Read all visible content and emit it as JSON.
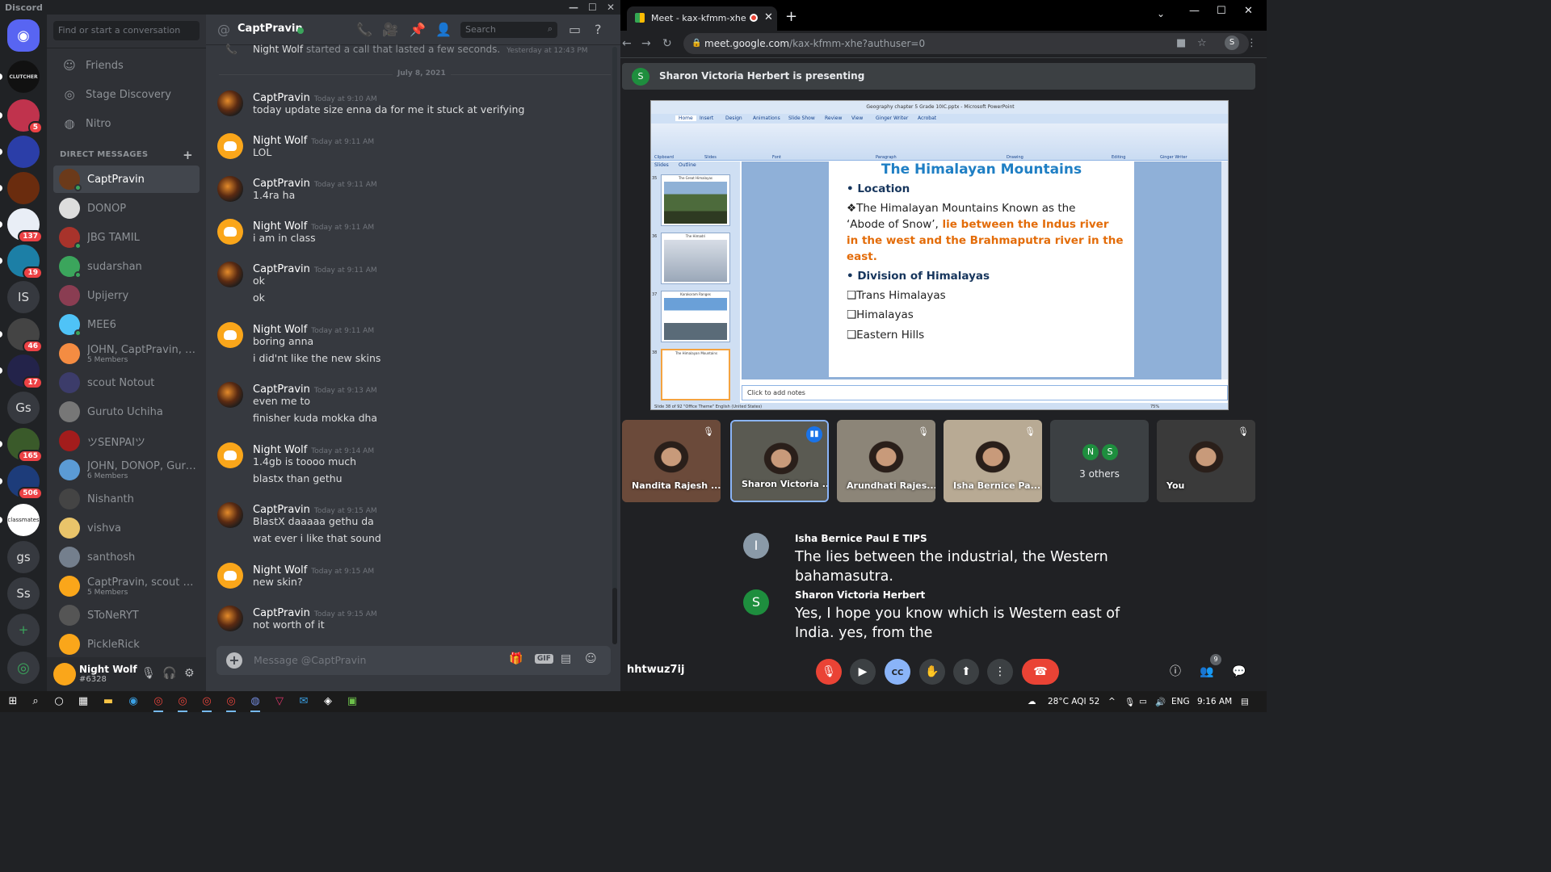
{
  "discord": {
    "app_title": "Discord",
    "guilds": [
      {
        "label": "",
        "badge": "",
        "color": "#5865f2",
        "icon": "discord-logo-icon"
      },
      {
        "label": "CLUTCHER",
        "badge": "",
        "color": "#111111"
      },
      {
        "label": "",
        "badge": "5",
        "color": "#c0334d"
      },
      {
        "label": "",
        "badge": "",
        "color": "#2b3ea8"
      },
      {
        "label": "",
        "badge": "",
        "color": "#6a2c0e"
      },
      {
        "label": "",
        "badge": "137",
        "color": "#e9eef6"
      },
      {
        "label": "",
        "badge": "19",
        "color": "#1c7fa6"
      },
      {
        "label": "IS",
        "badge": "",
        "color": "#36393f"
      },
      {
        "label": "",
        "badge": "46",
        "color": "#444444"
      },
      {
        "label": "",
        "badge": "17",
        "color": "#23234a"
      },
      {
        "label": "Gs",
        "badge": "",
        "color": "#36393f"
      },
      {
        "label": "",
        "badge": "165",
        "color": "#3a5a2a"
      },
      {
        "label": "",
        "badge": "506",
        "color": "#1d3c7a"
      },
      {
        "label": "classmates",
        "badge": "",
        "color": "#ffffff"
      },
      {
        "label": "gs",
        "badge": "",
        "color": "#36393f"
      },
      {
        "label": "Ss",
        "badge": "",
        "color": "#36393f"
      },
      {
        "label": "+",
        "badge": "",
        "color": "#36393f"
      },
      {
        "label": "",
        "badge": "",
        "color": "#36393f",
        "icon": "compass-icon"
      }
    ],
    "search_placeholder": "Find or start a conversation",
    "nav": [
      {
        "label": "Friends",
        "icon": "friends-icon"
      },
      {
        "label": "Stage Discovery",
        "icon": "stage-icon"
      },
      {
        "label": "Nitro",
        "icon": "nitro-icon"
      }
    ],
    "dm_header": "DIRECT MESSAGES",
    "dms": [
      {
        "name": "CaptPravin",
        "sub": "",
        "color": "#6b3a1a",
        "active": true
      },
      {
        "name": "DONOP",
        "sub": "",
        "color": "#dddddd"
      },
      {
        "name": "JBG TAMIL",
        "sub": "",
        "color": "#a8332b"
      },
      {
        "name": "sudarshan",
        "sub": "",
        "color": "#3ba55c"
      },
      {
        "name": "Upijerry",
        "sub": "",
        "color": "#8a3d52"
      },
      {
        "name": "MEE6",
        "sub": "",
        "color": "#4fc3f7"
      },
      {
        "name": "JOHN, CaptPravin, D...",
        "sub": "5 Members",
        "color": "#f48c42"
      },
      {
        "name": "scout Notout",
        "sub": "",
        "color": "#3c3c6a"
      },
      {
        "name": "Guruto Uchiha",
        "sub": "",
        "color": "#777777"
      },
      {
        "name": "ツSENPAIツ",
        "sub": "",
        "color": "#a31c1c"
      },
      {
        "name": "JOHN, DONOP, Guru...",
        "sub": "6 Members",
        "color": "#5b9bd5"
      },
      {
        "name": "Nishanth",
        "sub": "",
        "color": "#444444"
      },
      {
        "name": "vishva",
        "sub": "",
        "color": "#e9c46a"
      },
      {
        "name": "santhosh",
        "sub": "",
        "color": "#747f8d"
      },
      {
        "name": "CaptPravin, scout No...",
        "sub": "5 Members",
        "color": "#faa61a"
      },
      {
        "name": "SToNeRYT",
        "sub": "",
        "color": "#555555"
      },
      {
        "name": "PickleRick",
        "sub": "",
        "color": "#faa61a"
      }
    ],
    "user": {
      "name": "Night Wolf",
      "tag": "#6328"
    },
    "chat": {
      "channel": "CaptPravin",
      "search_placeholder": "Search",
      "system": {
        "author": "Night Wolf",
        "text": "started a call that lasted a few seconds.",
        "time": "Yesterday at 12:43 PM"
      },
      "date_divider": "July 8, 2021",
      "messages": [
        {
          "author": "CaptPravin",
          "time": "Today at 9:10 AM",
          "lines": [
            "today update size enna da for me it stuck at verifying"
          ]
        },
        {
          "author": "Night Wolf",
          "time": "Today at 9:11 AM",
          "lines": [
            "LOL"
          ]
        },
        {
          "author": "CaptPravin",
          "time": "Today at 9:11 AM",
          "lines": [
            "1.4ra ha"
          ]
        },
        {
          "author": "Night Wolf",
          "time": "Today at 9:11 AM",
          "lines": [
            "i am in class"
          ]
        },
        {
          "author": "CaptPravin",
          "time": "Today at 9:11 AM",
          "lines": [
            "ok",
            "ok"
          ]
        },
        {
          "author": "Night Wolf",
          "time": "Today at 9:11 AM",
          "lines": [
            "boring anna",
            "i did'nt like the new skins"
          ]
        },
        {
          "author": "CaptPravin",
          "time": "Today at 9:13 AM",
          "lines": [
            "even me to",
            "finisher kuda mokka dha"
          ]
        },
        {
          "author": "Night Wolf",
          "time": "Today at 9:14 AM",
          "lines": [
            "1.4gb is toooo much",
            "blastx than gethu"
          ]
        },
        {
          "author": "CaptPravin",
          "time": "Today at 9:15 AM",
          "lines": [
            "BlastX  daaaaa gethu da",
            "wat ever i like that sound"
          ]
        },
        {
          "author": "Night Wolf",
          "time": "Today at 9:15 AM",
          "lines": [
            "new skin?"
          ]
        },
        {
          "author": "CaptPravin",
          "time": "Today at 9:15 AM",
          "lines": [
            "not worth of it"
          ]
        }
      ],
      "composer_placeholder": "Message @CaptPravin",
      "gif_label": "GIF"
    }
  },
  "chrome": {
    "tab_title": "Meet - kax-kfmm-xhe",
    "url_host": "meet.google.com",
    "url_path": "/kax-kfmm-xhe?authuser=0",
    "profile_initial": "S"
  },
  "meet": {
    "presenting_initial": "S",
    "presenting_text": "Sharon Victoria Herbert is presenting",
    "ppt": {
      "window_title": "Geography chapter 5 Grade 10IC.pptx - Microsoft PowerPoint",
      "tabs": [
        "Home",
        "Insert",
        "Design",
        "Animations",
        "Slide Show",
        "Review",
        "View",
        "Ginger Writer",
        "Acrobat"
      ],
      "groups": [
        "Clipboard",
        "Slides",
        "Font",
        "Paragraph",
        "Drawing",
        "Editing",
        "Ginger Writer"
      ],
      "panel_tabs": [
        "Slides",
        "Outline"
      ],
      "thumbs": [
        {
          "num": "35",
          "caption": "The Great Himalayas"
        },
        {
          "num": "36",
          "caption": "The Himadri"
        },
        {
          "num": "37",
          "caption": "Karakoram Ranges"
        },
        {
          "num": "38",
          "caption": "The Himalayan Mountains"
        }
      ],
      "slide_title": "The Himalayan Mountains",
      "slide_lines": [
        {
          "text": "•  Location",
          "style": "h"
        },
        {
          "text": "❖The Himalayan Mountains Known as the",
          "style": ""
        },
        {
          "text": "   ‘Abode of Snow’,",
          "style": "",
          "orange": " lie between the Indus river"
        },
        {
          "text": "   in the west and the Brahmaputra river in the",
          "style": "o"
        },
        {
          "text": "   east.",
          "style": "o"
        },
        {
          "text": "•  Division of Himalayas",
          "style": "h"
        },
        {
          "text": "❑Trans Himalayas",
          "style": ""
        },
        {
          "text": "❑Himalayas",
          "style": ""
        },
        {
          "text": "❑Eastern Hills",
          "style": ""
        }
      ],
      "notes_placeholder": "Click to add notes",
      "status": "Slide 38 of 92     \"Office Theme\"     English (United States)",
      "zoom": "75%"
    },
    "tiles": [
      {
        "name": "Nandita Rajesh ...",
        "color": "#6b4a3a",
        "muted": true,
        "speaking": false
      },
      {
        "name": "Sharon Victoria ...",
        "color": "#5a5a52",
        "muted": false,
        "speaking": true
      },
      {
        "name": "Arundhati Rajes...",
        "color": "#8c8578",
        "muted": true,
        "speaking": false
      },
      {
        "name": "Isha Bernice Pa...",
        "color": "#b8aa94",
        "muted": true,
        "speaking": false
      },
      {
        "name": "You",
        "color": "#3a3a3a",
        "muted": true,
        "speaking": false
      }
    ],
    "others": {
      "initials": [
        "N",
        "S"
      ],
      "label": "3 others"
    },
    "captions": [
      {
        "initial": "I",
        "color": "#8a9aa8",
        "name": "Isha Bernice Paul E TIPS",
        "text": "The lies between the industrial, the Western bahamasutra."
      },
      {
        "initial": "S",
        "color": "#1e8e3e",
        "name": "Sharon Victoria Herbert",
        "text": "Yes, I hope you know which is Western east of India. yes, from the"
      }
    ],
    "meeting_code": "hhtwuz7ij",
    "participants_count": "9"
  },
  "taskbar": {
    "weather": "28°C  AQI 52",
    "lang": "ENG",
    "time": "9:16 AM"
  }
}
